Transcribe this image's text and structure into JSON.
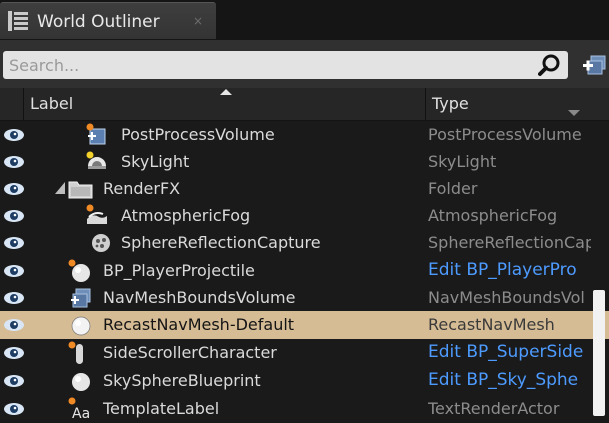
{
  "tab": {
    "title": "World Outliner",
    "close": "×",
    "icon": "list-icon"
  },
  "search": {
    "placeholder": "Search...",
    "value": ""
  },
  "columns": {
    "label": "Label",
    "type": "Type"
  },
  "colors": {
    "selected_row": "#d6bc95",
    "link": "#4d9bff",
    "type_text": "#8c8c8c"
  },
  "rows": [
    {
      "name": "PostProcessVolume",
      "type": "PostProcessVolume",
      "icon": "volume-icon",
      "link": false
    },
    {
      "name": "SkyLight",
      "type": "SkyLight",
      "icon": "skylight-icon",
      "link": false
    },
    {
      "name": "RenderFX",
      "type": "Folder",
      "icon": "folder-icon",
      "link": false,
      "expanded": true
    },
    {
      "name": "AtmosphericFog",
      "type": "AtmosphericFog",
      "icon": "fog-icon",
      "link": false
    },
    {
      "name": "SphereReflectionCapture",
      "type": "SphereReflectionCap",
      "icon": "reflection-capture-icon",
      "link": false
    },
    {
      "name": "BP_PlayerProjectile",
      "type": "Edit BP_PlayerPro",
      "icon": "blueprint-sphere-icon",
      "link": true
    },
    {
      "name": "NavMeshBoundsVolume",
      "type": "NavMeshBoundsVol",
      "icon": "volume-icon",
      "link": false
    },
    {
      "name": "RecastNavMesh-Default",
      "type": "RecastNavMesh",
      "icon": "sphere-icon",
      "link": false,
      "selected": true
    },
    {
      "name": "SideScrollerCharacter",
      "type": "Edit BP_SuperSide",
      "icon": "character-icon",
      "link": true
    },
    {
      "name": "SkySphereBlueprint",
      "type": "Edit BP_Sky_Sphe",
      "icon": "sphere-icon",
      "link": true
    },
    {
      "name": "TemplateLabel",
      "type": "TextRenderActor",
      "icon": "text-render-icon",
      "link": false
    }
  ]
}
